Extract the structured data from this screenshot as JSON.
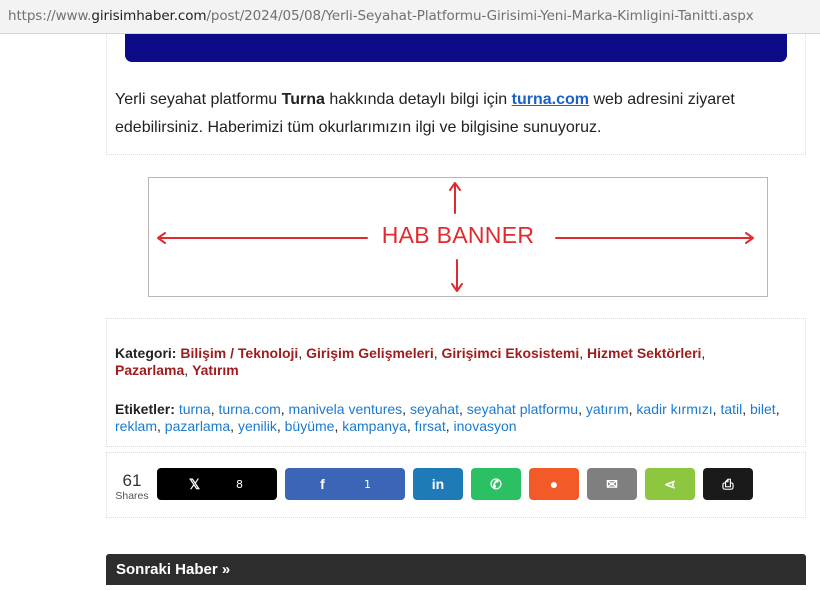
{
  "browser": {
    "url_prefix": "https://www.",
    "url_host": "girisimhaber.com",
    "url_path": "/post/2024/05/08/Yerli-Seyahat-Platformu-Girisimi-Yeni-Marka-Kimligini-Tanitti.aspx"
  },
  "article": {
    "p1": "Yerli seyahat platformu ",
    "brand": "Turna",
    "p2": " hakkında detaylı bilgi için ",
    "link": "turna.com",
    "p3": " web adresini ziyaret edebilirsiniz. Haberimizi tüm okurlarımızın ilgi ve bilgisine sunuyoruz."
  },
  "banner": {
    "text": "HAB BANNER"
  },
  "categories": {
    "label": "Kategori:",
    "items": [
      "Bilişim / Teknoloji",
      "Girişim Gelişmeleri",
      "Girişimci Ekosistemi",
      "Hizmet Sektörleri",
      "Pazarlama",
      "Yatırım"
    ]
  },
  "tags": {
    "label": "Etiketler:",
    "items": [
      "turna",
      "turna.com",
      "manivela ventures",
      "seyahat",
      "seyahat platformu",
      "yatırım",
      "kadir kırmızı",
      "tatil",
      "bilet",
      "reklam",
      "pazarlama",
      "yenilik",
      "büyüme",
      "kampanya",
      "fırsat",
      "inovasyon"
    ]
  },
  "share": {
    "total": "61",
    "total_label": "Shares",
    "buttons": [
      {
        "icon": "x-icon",
        "glyph": "𝕏",
        "count": "8",
        "color": "#000000"
      },
      {
        "icon": "facebook-icon",
        "glyph": "f",
        "count": "1",
        "color": "#3b66b7"
      },
      {
        "icon": "linkedin-icon",
        "glyph": "in",
        "count": "",
        "color": "#1f7ab8"
      },
      {
        "icon": "whatsapp-icon",
        "glyph": "✆",
        "count": "",
        "color": "#2bc063"
      },
      {
        "icon": "reddit-icon",
        "glyph": "●",
        "count": "",
        "color": "#f25a28"
      },
      {
        "icon": "email-icon",
        "glyph": "✉",
        "count": "",
        "color": "#7f7f7f"
      },
      {
        "icon": "share-icon",
        "glyph": "⋖",
        "count": "",
        "color": "#8dc63f"
      },
      {
        "icon": "print-icon",
        "glyph": "⎙",
        "count": "",
        "color": "#1a1a1a"
      }
    ]
  },
  "next": {
    "label": "Sonraki Haber »"
  }
}
